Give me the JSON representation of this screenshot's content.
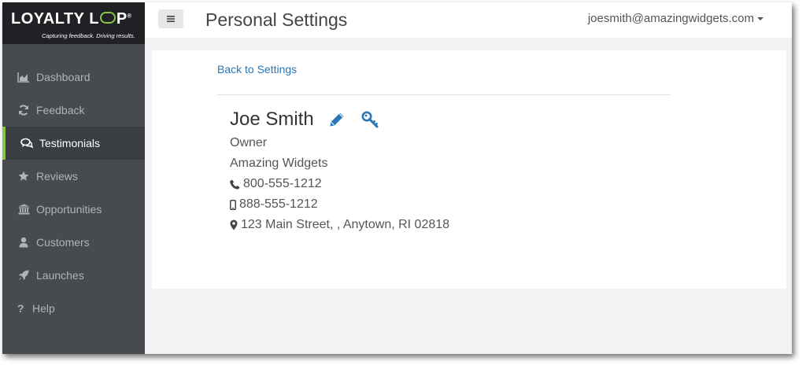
{
  "brand": {
    "logo_word_1": "LOYALTY L",
    "logo_word_2": "P",
    "registered": "®",
    "tagline": "Capturing feedback. Driving results.",
    "accent_color": "#8bc34a",
    "link_color": "#2a77b8"
  },
  "sidebar": {
    "items": [
      {
        "label": "Dashboard",
        "icon": "area-chart-icon",
        "active": false
      },
      {
        "label": "Feedback",
        "icon": "refresh-icon",
        "active": false
      },
      {
        "label": "Testimonials",
        "icon": "comments-icon",
        "active": true
      },
      {
        "label": "Reviews",
        "icon": "star-icon",
        "active": false
      },
      {
        "label": "Opportunities",
        "icon": "bank-icon",
        "active": false
      },
      {
        "label": "Customers",
        "icon": "user-icon",
        "active": false
      },
      {
        "label": "Launches",
        "icon": "rocket-icon",
        "active": false
      },
      {
        "label": "Help",
        "icon": "question-icon",
        "active": false
      }
    ]
  },
  "header": {
    "menu_icon": "hamburger-icon",
    "title": "Personal Settings",
    "user_email": "joesmith@amazingwidgets.com"
  },
  "main": {
    "back_link": "Back to Settings",
    "profile": {
      "name": "Joe Smith",
      "role": "Owner",
      "company": "Amazing Widgets",
      "phone": "800-555-1212",
      "mobile": "888-555-1212",
      "address": "123 Main Street, , Anytown, RI 02818"
    }
  }
}
